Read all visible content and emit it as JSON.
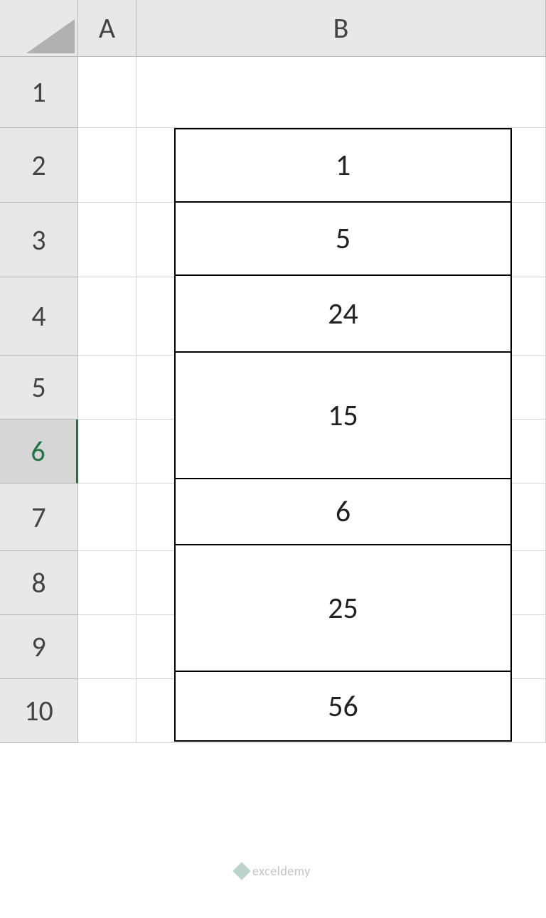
{
  "columns": [
    "A",
    "B"
  ],
  "rows": [
    "1",
    "2",
    "3",
    "4",
    "5",
    "6",
    "7",
    "8",
    "9",
    "10"
  ],
  "selected_row_index": 5,
  "data_cells": [
    {
      "value": "1",
      "height": 105
    },
    {
      "value": "5",
      "height": 105
    },
    {
      "value": "24",
      "height": 110
    },
    {
      "value": "15",
      "height": 180
    },
    {
      "value": "6",
      "height": 95
    },
    {
      "value": "25",
      "height": 180
    },
    {
      "value": "56",
      "height": 100
    }
  ],
  "watermark": {
    "text": "exceldemy"
  }
}
